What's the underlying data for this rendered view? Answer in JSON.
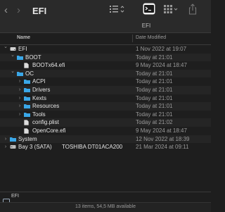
{
  "window": {
    "title": "EFI",
    "back_glyph": "‹",
    "forward_glyph": "›"
  },
  "toolbar": {
    "icons": [
      "list-view-icon",
      "terminal-icon",
      "grid-icon",
      "share-icon"
    ]
  },
  "tab": {
    "label": "EFI"
  },
  "columns": {
    "name": "Name",
    "date": "Date Modified"
  },
  "rows": [
    {
      "name": "EFI",
      "date": "1 Nov 2022 at 19:07",
      "kind": "disk",
      "expanded": true,
      "depth": 0
    },
    {
      "name": "BOOT",
      "date": "Today at 21:01",
      "kind": "folder",
      "expanded": true,
      "depth": 1
    },
    {
      "name": "BOOTx64.efi",
      "date": "9 May 2024 at 18:47",
      "kind": "file",
      "depth": 2
    },
    {
      "name": "OC",
      "date": "Today at 21:01",
      "kind": "folder",
      "expanded": true,
      "depth": 1
    },
    {
      "name": "ACPI",
      "date": "Today at 21:01",
      "kind": "folder",
      "expanded": false,
      "depth": 2
    },
    {
      "name": "Drivers",
      "date": "Today at 21:01",
      "kind": "folder",
      "expanded": false,
      "depth": 2
    },
    {
      "name": "Kexts",
      "date": "Today at 21:01",
      "kind": "folder",
      "expanded": false,
      "depth": 2
    },
    {
      "name": "Resources",
      "date": "Today at 21:01",
      "kind": "folder",
      "expanded": false,
      "depth": 2
    },
    {
      "name": "Tools",
      "date": "Today at 21:01",
      "kind": "folder",
      "expanded": false,
      "depth": 2
    },
    {
      "name": "config.plist",
      "date": "Today at 21:02",
      "kind": "file",
      "depth": 2
    },
    {
      "name": "OpenCore.efi",
      "date": "9 May 2024 at 18:47",
      "kind": "file",
      "depth": 2
    },
    {
      "name": "System",
      "date": "12 Nov 2022 at 18:39",
      "kind": "folder",
      "expanded": false,
      "depth": 0
    },
    {
      "name": "Bay 3 (SATA)",
      "extra": "TOSHIBA DT01ACA200",
      "date": "21 Mar 2024 at 09:11",
      "kind": "drive",
      "expanded": false,
      "depth": 0
    }
  ],
  "pathbar": {
    "label": "EFI"
  },
  "status": {
    "text": "13 items, 54,5 MB available"
  },
  "colors": {
    "folder": "#3aa7e8",
    "accent": "#2a84d2",
    "background": "#1e1e1e"
  }
}
